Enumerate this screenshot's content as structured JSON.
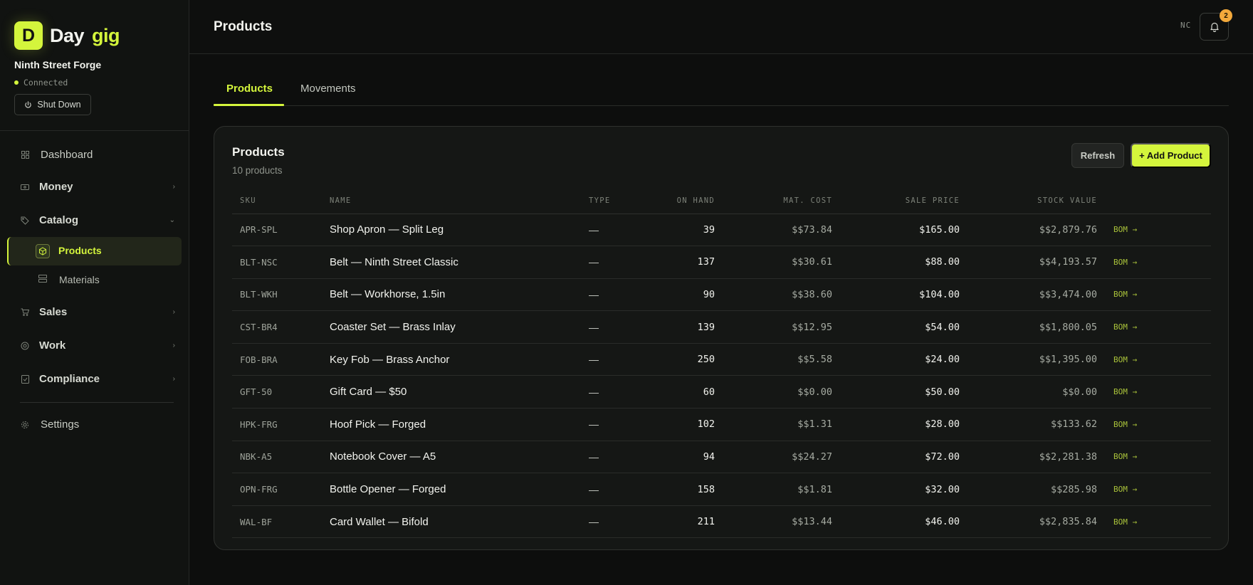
{
  "brand": {
    "logo_letter": "D",
    "name_part1": "Day",
    "name_part2": "gig",
    "accent_color": "#d4f53c"
  },
  "workspace": {
    "name": "Ninth Street Forge",
    "status": "Connected",
    "shutdown_label": "Shut Down"
  },
  "sidebar": {
    "dashboard": "Dashboard",
    "money": "Money",
    "catalog": "Catalog",
    "catalog_products": "Products",
    "catalog_materials": "Materials",
    "sales": "Sales",
    "work": "Work",
    "compliance": "Compliance",
    "settings": "Settings"
  },
  "header": {
    "title": "Products",
    "user_initials": "NC",
    "notification_count": "2"
  },
  "tabs": [
    {
      "label": "Products",
      "active": true
    },
    {
      "label": "Movements",
      "active": false
    }
  ],
  "card": {
    "title": "Products",
    "subtitle": "10 products",
    "refresh_label": "Refresh",
    "add_label": "+ Add Product"
  },
  "table": {
    "columns": [
      "SKU",
      "NAME",
      "TYPE",
      "ON HAND",
      "MAT. COST",
      "SALE PRICE",
      "STOCK VALUE"
    ],
    "rows": [
      {
        "sku": "APR-SPL",
        "name": "Shop Apron — Split Leg",
        "type": "—",
        "on_hand": "39",
        "mat_cost": "$$73.84",
        "sale_price": "$165.00",
        "stock_value": "$$2,879.76",
        "action": "BOM →"
      },
      {
        "sku": "BLT-NSC",
        "name": "Belt — Ninth Street Classic",
        "type": "—",
        "on_hand": "137",
        "mat_cost": "$$30.61",
        "sale_price": "$88.00",
        "stock_value": "$$4,193.57",
        "action": "BOM →"
      },
      {
        "sku": "BLT-WKH",
        "name": "Belt — Workhorse, 1.5in",
        "type": "—",
        "on_hand": "90",
        "mat_cost": "$$38.60",
        "sale_price": "$104.00",
        "stock_value": "$$3,474.00",
        "action": "BOM →"
      },
      {
        "sku": "CST-BR4",
        "name": "Coaster Set — Brass Inlay",
        "type": "—",
        "on_hand": "139",
        "mat_cost": "$$12.95",
        "sale_price": "$54.00",
        "stock_value": "$$1,800.05",
        "action": "BOM →"
      },
      {
        "sku": "FOB-BRA",
        "name": "Key Fob — Brass Anchor",
        "type": "—",
        "on_hand": "250",
        "mat_cost": "$$5.58",
        "sale_price": "$24.00",
        "stock_value": "$$1,395.00",
        "action": "BOM →"
      },
      {
        "sku": "GFT-50",
        "name": "Gift Card — $50",
        "type": "—",
        "on_hand": "60",
        "mat_cost": "$$0.00",
        "sale_price": "$50.00",
        "stock_value": "$$0.00",
        "action": "BOM →"
      },
      {
        "sku": "HPK-FRG",
        "name": "Hoof Pick — Forged",
        "type": "—",
        "on_hand": "102",
        "mat_cost": "$$1.31",
        "sale_price": "$28.00",
        "stock_value": "$$133.62",
        "action": "BOM →"
      },
      {
        "sku": "NBK-A5",
        "name": "Notebook Cover — A5",
        "type": "—",
        "on_hand": "94",
        "mat_cost": "$$24.27",
        "sale_price": "$72.00",
        "stock_value": "$$2,281.38",
        "action": "BOM →"
      },
      {
        "sku": "OPN-FRG",
        "name": "Bottle Opener — Forged",
        "type": "—",
        "on_hand": "158",
        "mat_cost": "$$1.81",
        "sale_price": "$32.00",
        "stock_value": "$$285.98",
        "action": "BOM →"
      },
      {
        "sku": "WAL-BF",
        "name": "Card Wallet — Bifold",
        "type": "—",
        "on_hand": "211",
        "mat_cost": "$$13.44",
        "sale_price": "$46.00",
        "stock_value": "$$2,835.84",
        "action": "BOM →"
      }
    ]
  }
}
